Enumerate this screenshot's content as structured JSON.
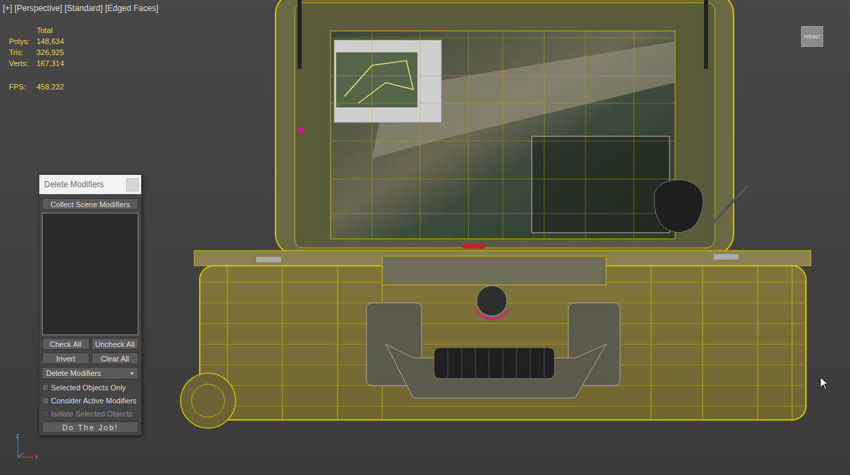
{
  "viewport": {
    "label": "[+] [Perspective] [Standard] [Edged Faces]",
    "stats": {
      "heading": "Total",
      "rows": [
        {
          "label": "Polys:",
          "value": "148,634"
        },
        {
          "label": "Tris:",
          "value": "326,925"
        },
        {
          "label": "Verts:",
          "value": "167,314"
        }
      ],
      "fps": {
        "label": "FPS:",
        "value": "458.232"
      }
    },
    "viewcube": "FRONT",
    "axes": {
      "up": "z",
      "right": "x"
    }
  },
  "dialog": {
    "title": "Delete Modifiers",
    "collect_button": "Collect Scene Modifiers",
    "list": {
      "items": []
    },
    "button_rows": [
      [
        "Check All",
        "Uncheck All"
      ],
      [
        "Invert",
        "Clear All"
      ]
    ],
    "dropdown": {
      "value": "Delete Modifiers",
      "arrow": "▼"
    },
    "options": [
      {
        "label": "Selected Objects Only",
        "checked": false,
        "disabled": false
      },
      {
        "label": "Consider Active Modifiers",
        "checked": false,
        "disabled": false
      },
      {
        "label": "Isolate Selected Objects",
        "checked": false,
        "disabled": true
      }
    ],
    "run_button": "Do The Job!"
  }
}
